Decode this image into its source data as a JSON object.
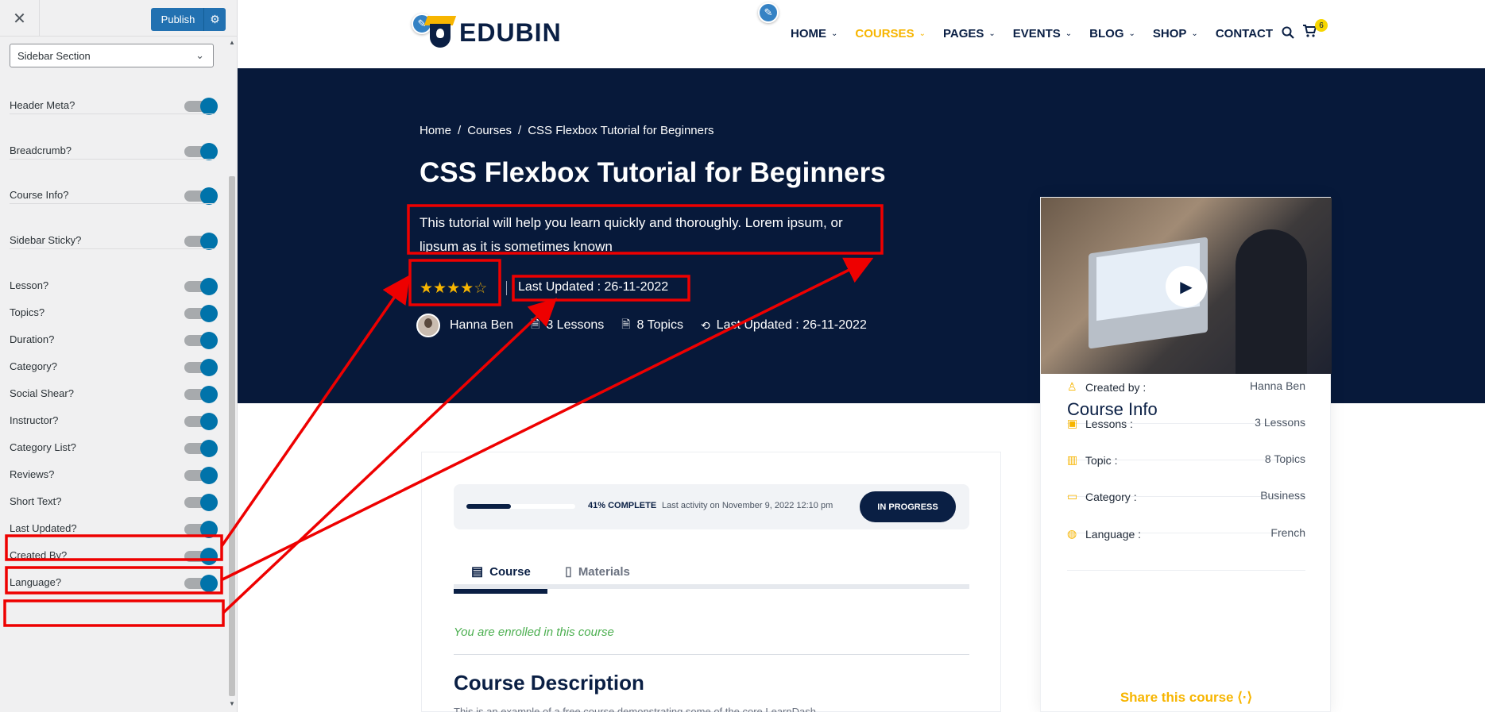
{
  "customizer": {
    "close_glyph": "✕",
    "publish_label": "Publish",
    "section_select": "Sidebar Section",
    "toggles": [
      {
        "label": "Header Meta?",
        "on": true
      },
      {
        "label": "Breadcrumb?",
        "on": true
      },
      {
        "label": "Course Info?",
        "on": true
      },
      {
        "label": "Sidebar Sticky?",
        "on": true
      },
      {
        "label": "Lesson?",
        "on": true
      },
      {
        "label": "Topics?",
        "on": true
      },
      {
        "label": "Duration?",
        "on": true
      },
      {
        "label": "Category?",
        "on": true
      },
      {
        "label": "Social Shear?",
        "on": true
      },
      {
        "label": "Instructor?",
        "on": true
      },
      {
        "label": "Category List?",
        "on": true
      },
      {
        "label": "Reviews?",
        "on": true
      },
      {
        "label": "Short Text?",
        "on": true
      },
      {
        "label": "Last Updated?",
        "on": true
      },
      {
        "label": "Created By?",
        "on": true
      },
      {
        "label": "Language?",
        "on": true
      }
    ]
  },
  "header": {
    "logo_text": "EDUBIN",
    "nav": [
      {
        "label": "HOME",
        "dropdown": true,
        "active": false
      },
      {
        "label": "COURSES",
        "dropdown": true,
        "active": true
      },
      {
        "label": "PAGES",
        "dropdown": true,
        "active": false
      },
      {
        "label": "EVENTS",
        "dropdown": true,
        "active": false
      },
      {
        "label": "BLOG",
        "dropdown": true,
        "active": false
      },
      {
        "label": "SHOP",
        "dropdown": true,
        "active": false
      },
      {
        "label": "CONTACT",
        "dropdown": false,
        "active": false
      }
    ],
    "cart_count": "6"
  },
  "hero": {
    "breadcrumb": [
      "Home",
      "/",
      "Courses",
      "/",
      "CSS Flexbox Tutorial for Beginners"
    ],
    "title": "CSS Flexbox Tutorial for Beginners",
    "short_text": "This tutorial will help you learn quickly and thoroughly. Lorem ipsum, or lipsum as it is sometimes known",
    "rating": 4,
    "rating_max": 5,
    "last_updated": "Last Updated : 26-11-2022",
    "meta": {
      "author": "Hanna Ben",
      "lessons": "3 Lessons",
      "topics": "8 Topics",
      "last_updated": "Last Updated : 26-11-2022"
    }
  },
  "course_info": {
    "title": "Course Info",
    "rows": [
      {
        "icon": "user-icon",
        "key": "Created by :",
        "value": "Hanna Ben"
      },
      {
        "icon": "lesson-icon",
        "key": "Lessons :",
        "value": "3 Lessons"
      },
      {
        "icon": "book-icon",
        "key": "Topic :",
        "value": "8 Topics"
      },
      {
        "icon": "folder-icon",
        "key": "Category :",
        "value": "Business"
      },
      {
        "icon": "globe-icon",
        "key": "Language :",
        "value": "French"
      }
    ],
    "share_label": "Share this course"
  },
  "main": {
    "progress_fraction": 0.41,
    "percent_label": "41% COMPLETE",
    "last_activity": "Last activity on November 9, 2022 12:10 pm",
    "status": "IN PROGRESS",
    "tabs": [
      {
        "label": "Course",
        "active": true
      },
      {
        "label": "Materials",
        "active": false
      }
    ],
    "enrolled_text": "You are enrolled in this course",
    "description_title": "Course Description",
    "description_text": "This is an example of a free course demonstrating some of the core LearnDash"
  },
  "colors": {
    "navy": "#07193a",
    "accent": "#f7b500",
    "wp_blue": "#2271b1",
    "annotation_red": "#ee0000"
  }
}
